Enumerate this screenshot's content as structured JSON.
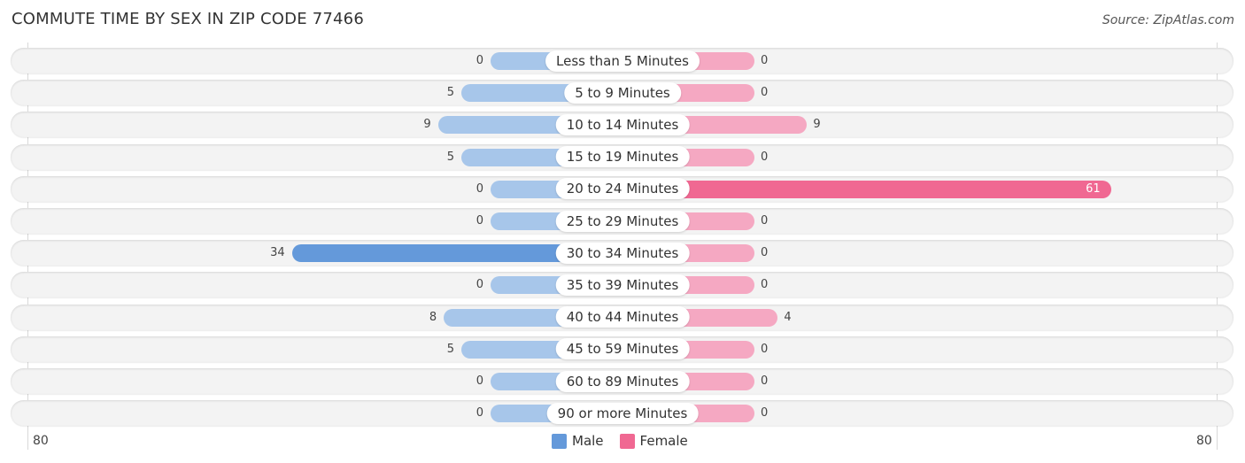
{
  "chart_data": {
    "type": "bar",
    "orientation": "horizontal-diverging",
    "title": "COMMUTE TIME BY SEX IN ZIP CODE 77466",
    "source": "Source: ZipAtlas.com",
    "categories": [
      "Less than 5 Minutes",
      "5 to 9 Minutes",
      "10 to 14 Minutes",
      "15 to 19 Minutes",
      "20 to 24 Minutes",
      "25 to 29 Minutes",
      "30 to 34 Minutes",
      "35 to 39 Minutes",
      "40 to 44 Minutes",
      "45 to 59 Minutes",
      "60 to 89 Minutes",
      "90 or more Minutes"
    ],
    "series": [
      {
        "name": "Male",
        "color": "#6499da",
        "light_color": "#a7c6ea",
        "values": [
          0,
          5,
          9,
          5,
          0,
          0,
          34,
          0,
          8,
          5,
          0,
          0
        ]
      },
      {
        "name": "Female",
        "color": "#f06892",
        "light_color": "#f5a8c2",
        "values": [
          0,
          0,
          9,
          0,
          61,
          0,
          0,
          0,
          4,
          0,
          0,
          0
        ]
      }
    ],
    "axis": {
      "left_label": "80",
      "right_label": "80",
      "range": [
        0,
        80
      ]
    },
    "legend": {
      "position": "bottom-center",
      "items": [
        "Male",
        "Female"
      ]
    }
  }
}
